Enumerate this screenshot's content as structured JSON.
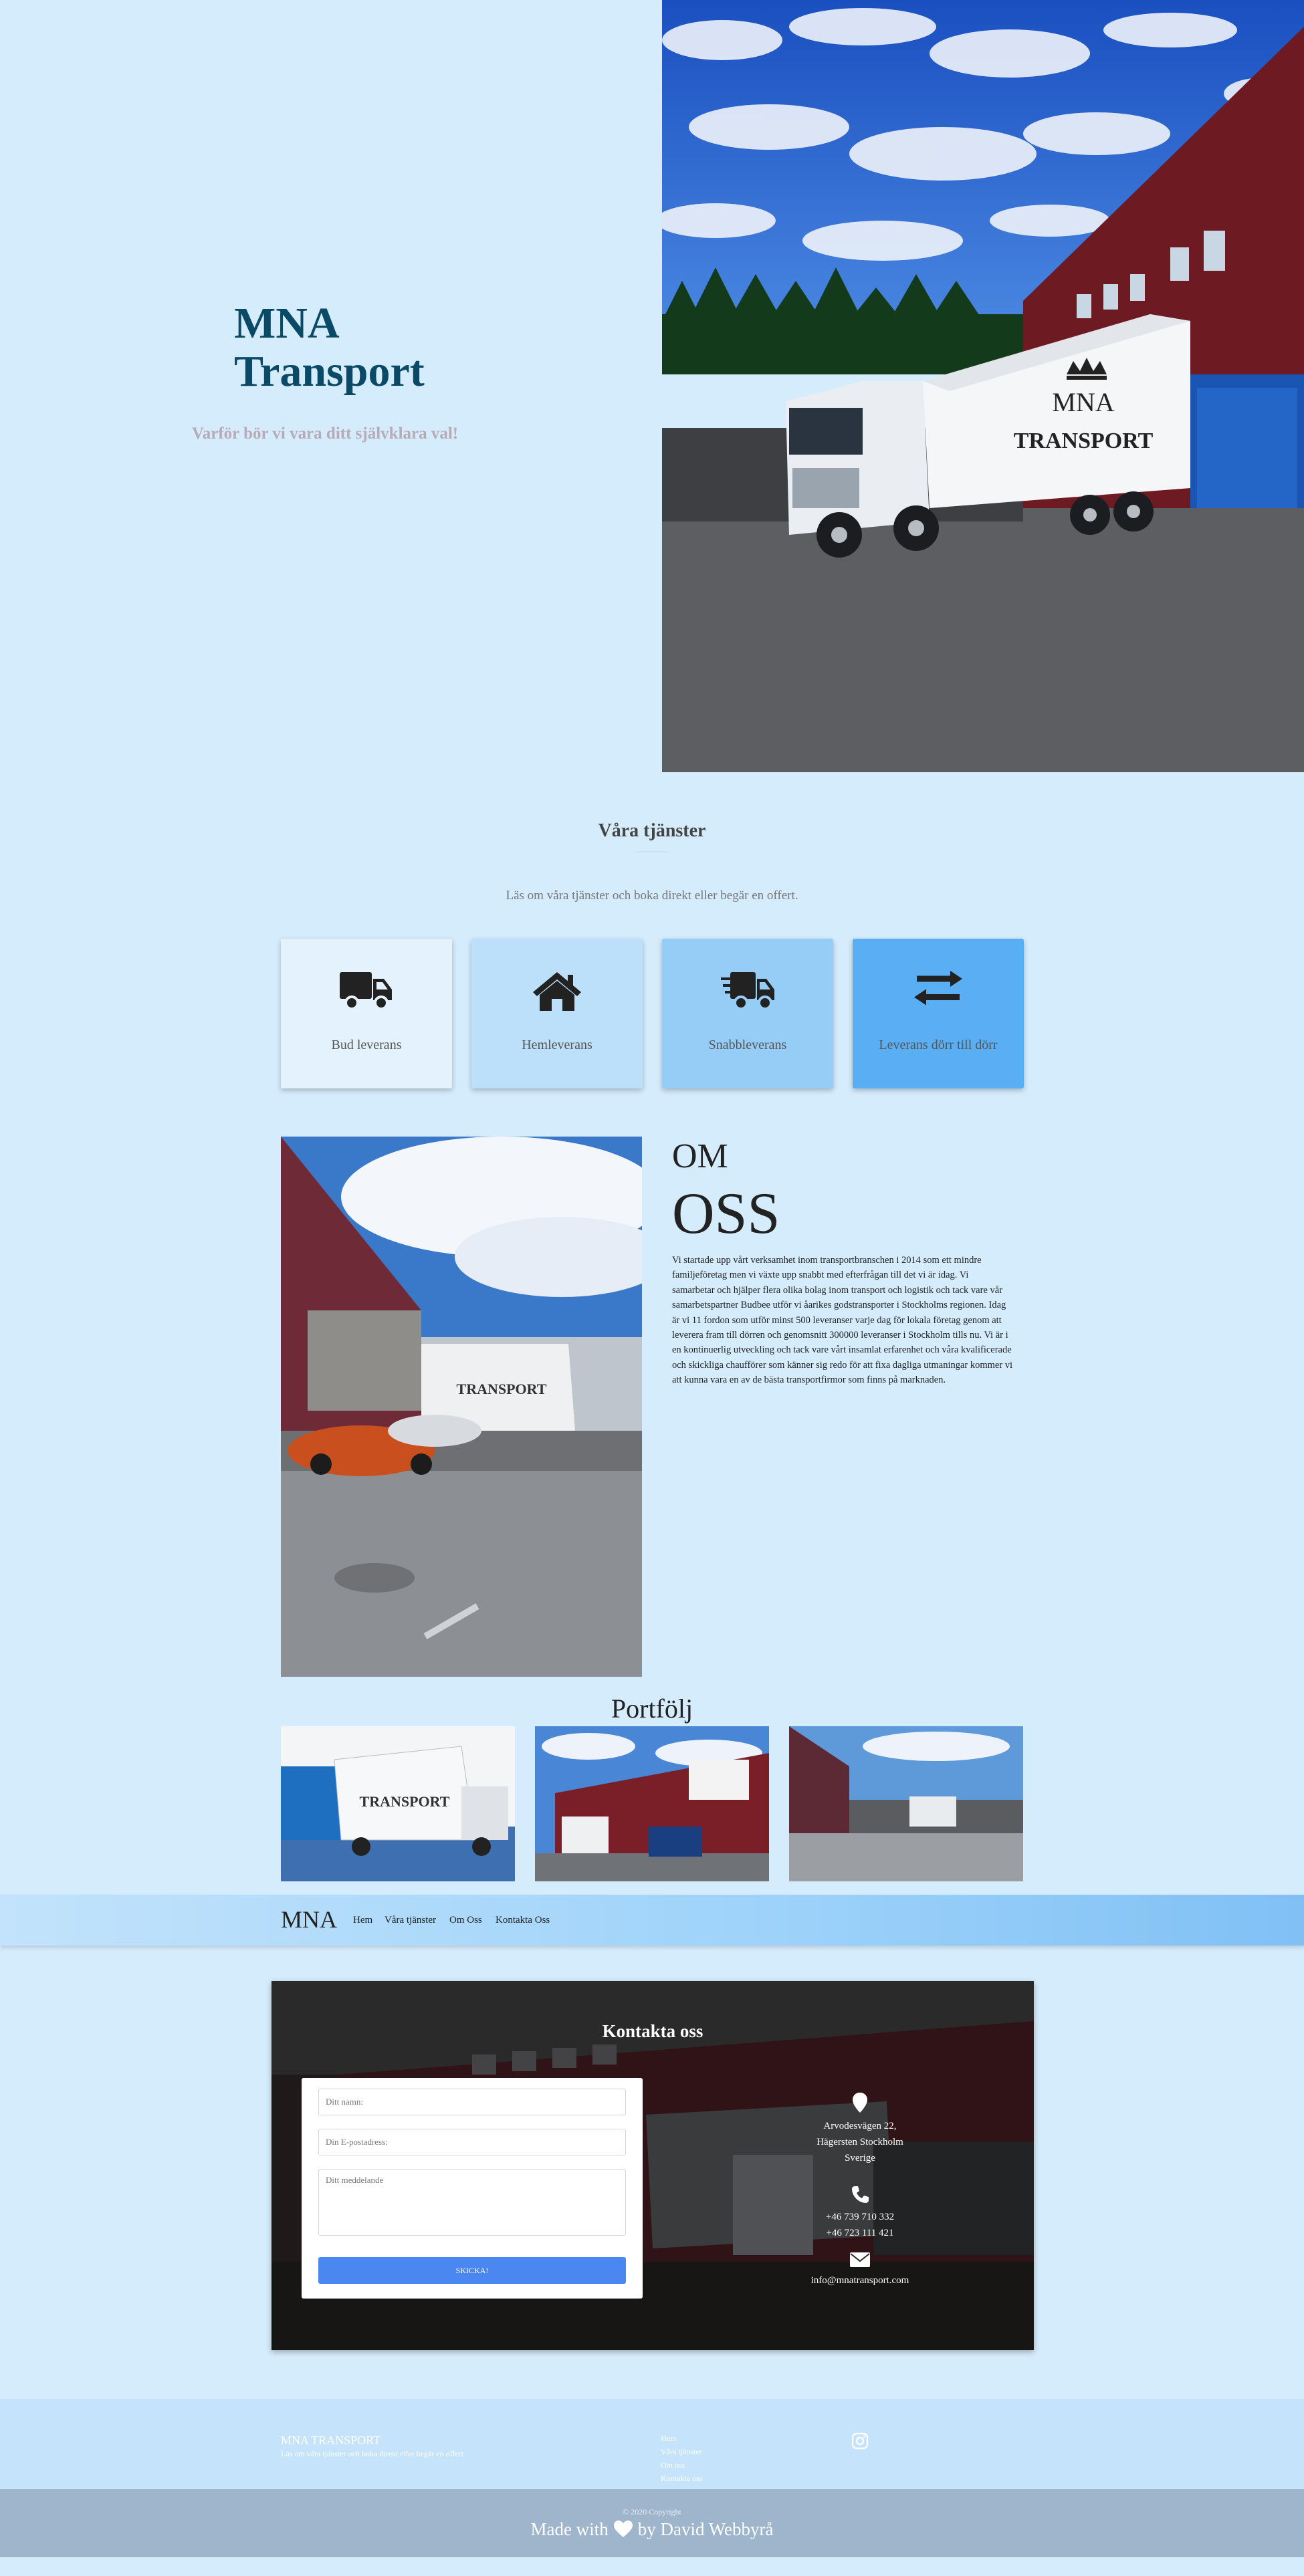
{
  "hero": {
    "brand_line1": "MNA",
    "brand_line2": "Transport",
    "tagline": "Varför bör vi vara ditt självklara val!",
    "truck_text": "MNA",
    "truck_text2": "TRANSPORT"
  },
  "services": {
    "title": "Våra tjänster",
    "subtitle": "Läs om våra tjänster och boka direkt eller begär en offert.",
    "cards": [
      {
        "label": "Bud leverans",
        "icon": "truck-icon",
        "bg": "#e4f2fe"
      },
      {
        "label": "Hemleverans",
        "icon": "home-icon",
        "bg": "#bde0fa"
      },
      {
        "label": "Snabbleverans",
        "icon": "fast-truck-icon",
        "bg": "#95cdf7"
      },
      {
        "label": "Leverans dörr till dörr",
        "icon": "exchange-arrows-icon",
        "bg": "#5aaef3"
      }
    ]
  },
  "about": {
    "heading_small": "OM",
    "heading_large": "OSS",
    "text": "Vi startade upp vårt verksamhet inom transportbranschen i 2014 som ett mindre familjeföretag men vi växte upp snabbt med efterfrågan till det vi är idag. Vi samarbetar och hjälper flera olika bolag inom transport och logistik och tack vare vår samarbetspartner Budbee utför vi åarikes godstransporter i Stockholms regionen. Idag är vi 11 fordon som utför minst 500 leveranser varje dag för lokala företag genom att leverera fram till dörren och genomsnitt 300000 leveranser i Stockholm tills nu. Vi är i en kontinuerlig utveckling och tack vare vårt insamlat erfarenhet och våra kvalificerade och skickliga chaufförer som känner sig redo för att fixa dagliga utmaningar kommer vi att kunna vara en av de bästa transportfirmor som finns på marknaden."
  },
  "portfolio": {
    "title": "Portfölj"
  },
  "nav": {
    "brand": "MNA",
    "links": [
      "Hem",
      "Våra tjänster",
      "Om Oss",
      "Kontakta Oss"
    ]
  },
  "contact": {
    "title": "Kontakta oss",
    "name_placeholder": "Ditt namn:",
    "email_placeholder": "Din E-postadress:",
    "message_placeholder": "Ditt meddelande",
    "submit_label": "SKICKA!",
    "address_line1": "Arvodesvägen 22,",
    "address_line2": "Hägersten Stockholm",
    "address_line3": "Sverige",
    "phone1": "+46 739 710 332",
    "phone2": "+46 723 111 421",
    "email": "info@mnatransport.com"
  },
  "footer": {
    "brand": "MNA TRANSPORT",
    "subtitle": "Läs om våra tjänster och boka direkt eller begär en offert",
    "links": [
      "Hem",
      "Våra tjänster",
      "Om oss",
      "Kontakta oss"
    ],
    "copyright": "© 2020 Copyright",
    "made_with": "Made with",
    "by": "by David Webbyrå"
  },
  "colors": {
    "page_bg": "#d5ecfc",
    "brand_title": "#0b4a66",
    "submit_button": "#4a87f0"
  }
}
